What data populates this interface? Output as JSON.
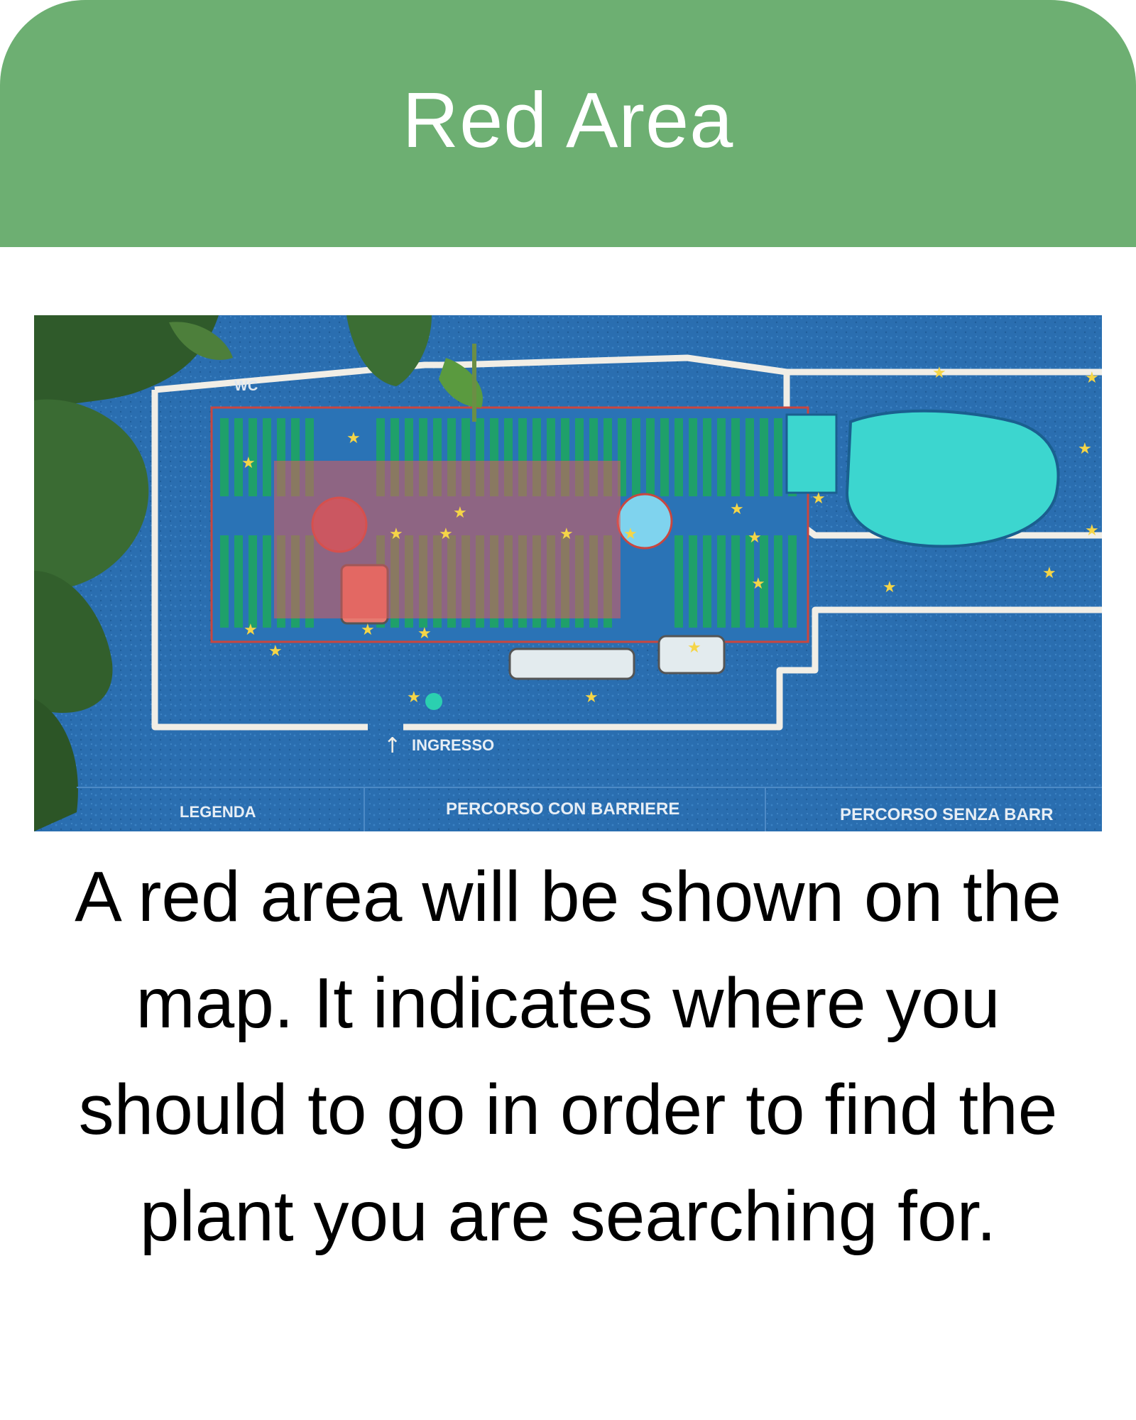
{
  "header": {
    "title": "Red Area"
  },
  "map": {
    "labels": {
      "wc": "WC",
      "entrance": "INGRESSO",
      "legend": "LEGENDA",
      "route_with_barriers": "PERCORSO CON BARRIERE",
      "route_without_barriers": "PERCORSO SENZA BARR"
    },
    "colors": {
      "background": "#2a6eb0",
      "beds": "#1fa06a",
      "pond": "#3cd6cf",
      "highlight": "#e05a5a",
      "paths": "#f1eee6"
    }
  },
  "description": "A red area will be shown on the map. It indicates where you should to go in order to find the plant you are searching for."
}
